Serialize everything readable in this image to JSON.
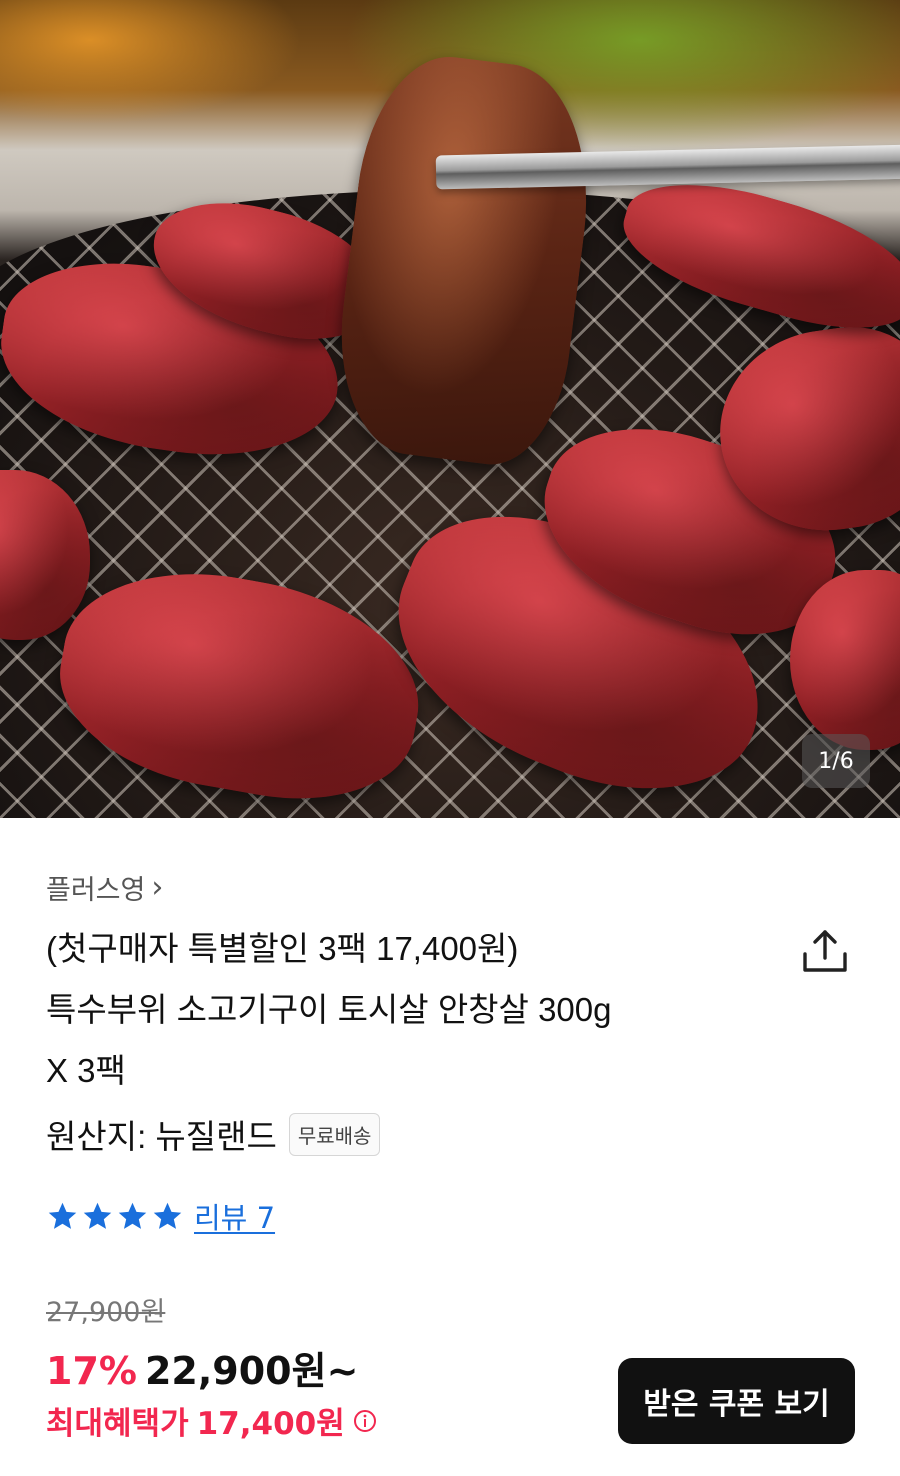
{
  "gallery": {
    "current": 1,
    "total": 6,
    "counter_text": "1/6"
  },
  "store": {
    "name": "플러스영",
    "arrow": "›"
  },
  "product": {
    "title_lines": [
      "(첫구매자 특별할인 3팩 17,400원)",
      "특수부위 소고기구이 토시살 안창살 300g",
      "X 3팩"
    ],
    "origin": "원산지: 뉴질랜드",
    "shipping_badge": "무료배송"
  },
  "rating": {
    "stars": 4,
    "review_label": "리뷰 7"
  },
  "price": {
    "original": "27,900원",
    "discount": "17%",
    "sale": "22,900원~",
    "max_benefit_label": "최대혜택가",
    "max_benefit_price": "17,400원"
  },
  "cta": {
    "coupon_label": "받은 쿠폰 보기"
  },
  "colors": {
    "accent_red": "#f2274f",
    "link_blue": "#1a6fdc",
    "star_blue": "#1a6fdc",
    "button_dark": "#111111"
  },
  "icons": {
    "share": "share-icon",
    "star": "star-icon",
    "info": "info-icon",
    "chevron": "chevron-right-icon"
  }
}
